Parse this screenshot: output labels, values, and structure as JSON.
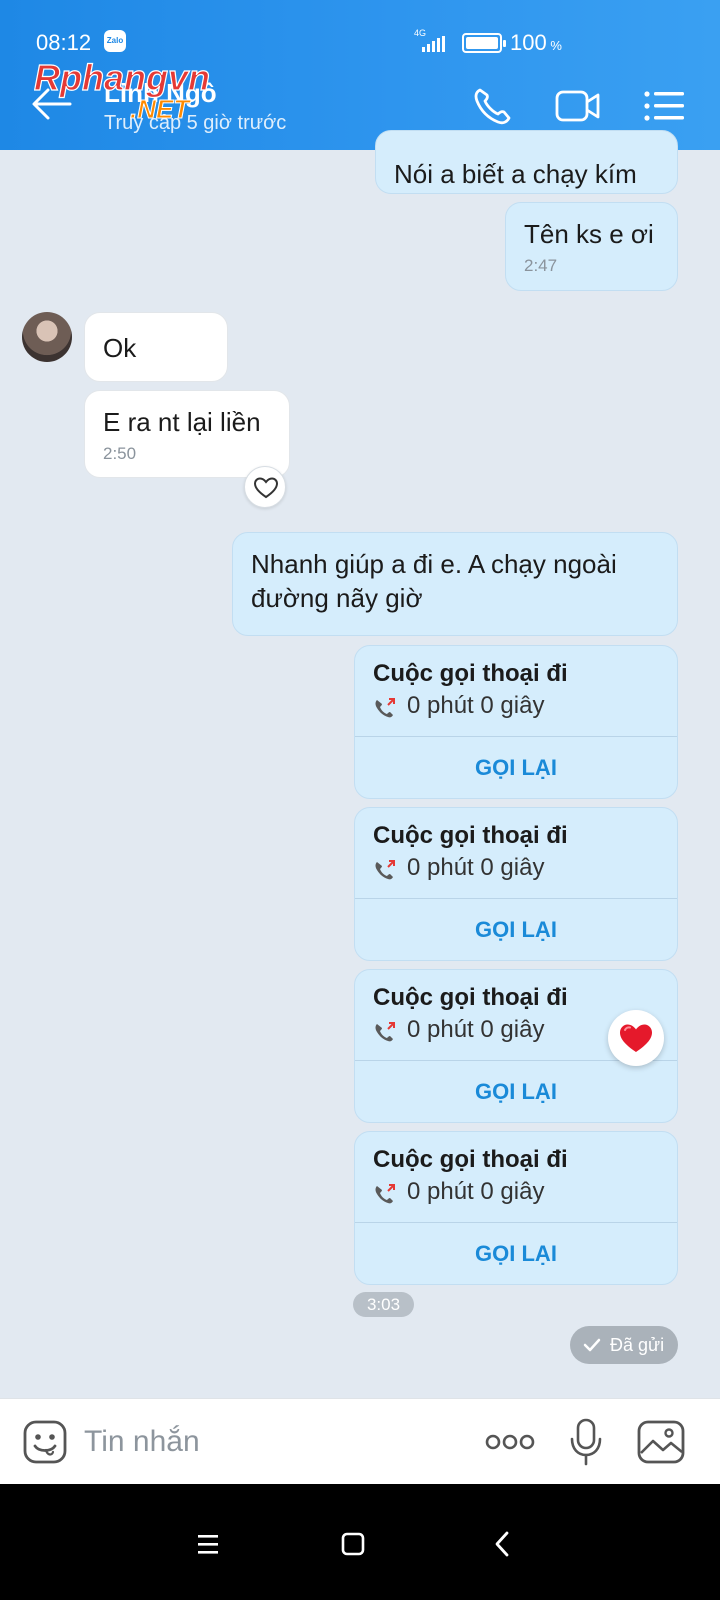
{
  "status_bar": {
    "time": "08:12",
    "app_chip": "Zalo",
    "network": "4G",
    "battery": "100",
    "battery_unit": "%"
  },
  "header": {
    "contact_name": "Linh Ngô",
    "contact_status": "Truy cập 5 giờ trước",
    "watermark_main": "Rphangvn",
    "watermark_sub": ".NET"
  },
  "messages": {
    "m1": {
      "text": "Nói a biết a chạy kím"
    },
    "m2": {
      "text": "Tên ks e ơi",
      "time": "2:47"
    },
    "m3": {
      "text": "Ok"
    },
    "m4": {
      "text": "E ra nt lại liền",
      "time": "2:50"
    },
    "m5": {
      "line1": "Nhanh giúp a đi e. A chạy ngoài",
      "line2": "đường nãy giờ"
    }
  },
  "calls": [
    {
      "title": "Cuộc gọi thoại đi",
      "duration": "0 phút 0 giây",
      "action": "GỌI LẠI"
    },
    {
      "title": "Cuộc gọi thoại đi",
      "duration": "0 phút 0 giây",
      "action": "GỌI LẠI"
    },
    {
      "title": "Cuộc gọi thoại đi",
      "duration": "0 phút 0 giây",
      "action": "GỌI LẠI"
    },
    {
      "title": "Cuộc gọi thoại đi",
      "duration": "0 phút 0 giây",
      "action": "GỌI LẠI"
    }
  ],
  "time_chip": "3:03",
  "sent_status": "Đã gửi",
  "composer": {
    "placeholder": "Tin nhắn"
  },
  "icons": [
    "back-arrow-icon",
    "phone-icon",
    "video-icon",
    "menu-icon",
    "heart-icon",
    "sticker-icon",
    "more-icon",
    "mic-icon",
    "image-icon"
  ],
  "colors": {
    "header": "#2e95ee",
    "my_bubble": "#d5edfc",
    "accent": "#1a8ad8",
    "background": "#e2e9f1"
  }
}
